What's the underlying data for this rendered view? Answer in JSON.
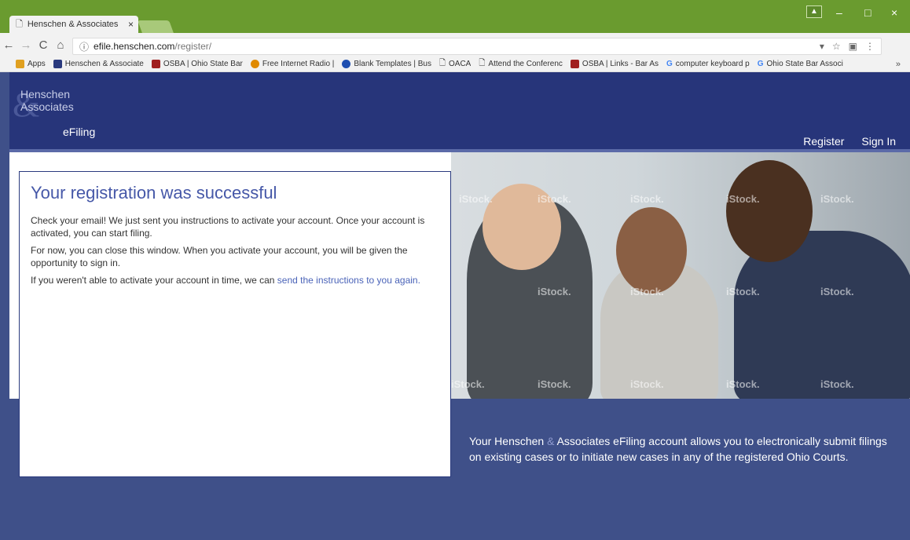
{
  "browser": {
    "tab_title": "Henschen & Associates",
    "tab_close": "×",
    "window_controls": [
      "–",
      "□",
      "×"
    ],
    "url_domain": "efile.henschen.com",
    "url_path": "/register/",
    "profile_label": "▲",
    "bookmarks": [
      {
        "label": "Apps",
        "color": "#e0a020"
      },
      {
        "label": "Henschen & Associate",
        "color": "#2a3a7e"
      },
      {
        "label": "OSBA | Ohio State Bar",
        "color": "#a02020"
      },
      {
        "label": "Free Internet Radio |",
        "color": "#e08a00"
      },
      {
        "label": "Blank Templates | Bus",
        "color": "#1f4fb0"
      },
      {
        "label": "OACA",
        "color": "#888888"
      },
      {
        "label": "Attend the Conferenc",
        "color": "#888888"
      },
      {
        "label": "OSBA | Links - Bar As",
        "color": "#a02020"
      },
      {
        "label": "computer keyboard p",
        "color": "#4285f4"
      },
      {
        "label": "Ohio State Bar Associ",
        "color": "#4285f4"
      }
    ],
    "bookmarks_more": "»"
  },
  "header": {
    "logo_amp": "&",
    "logo_line1": "Henschen",
    "logo_line2": "Associates",
    "logo_efiling": "eFiling",
    "nav": [
      "Register",
      "Sign In"
    ]
  },
  "card": {
    "title": "Your registration was successful",
    "p1": "Check your email! We just sent you instructions to activate your account. Once your account is activated, you can start filing.",
    "p2": "For now, you can close this window. When you activate your account, you will be given the opportunity to sign in.",
    "p3_prefix": "If you weren't able to activate your account in time, we can ",
    "p3_link": "send the instructions to you again."
  },
  "promo": {
    "part1": "Your Henschen ",
    "amp": "&",
    "part2": " Associates eFiling account allows you to electronically submit filings on existing cases or to initiate new cases in any of the registered Ohio Courts."
  },
  "photo": {
    "watermark": "iStock."
  },
  "colors": {
    "header": "#27357a",
    "page_bg": "#3f5089",
    "title": "#4658a8",
    "link": "#4a63b8"
  }
}
